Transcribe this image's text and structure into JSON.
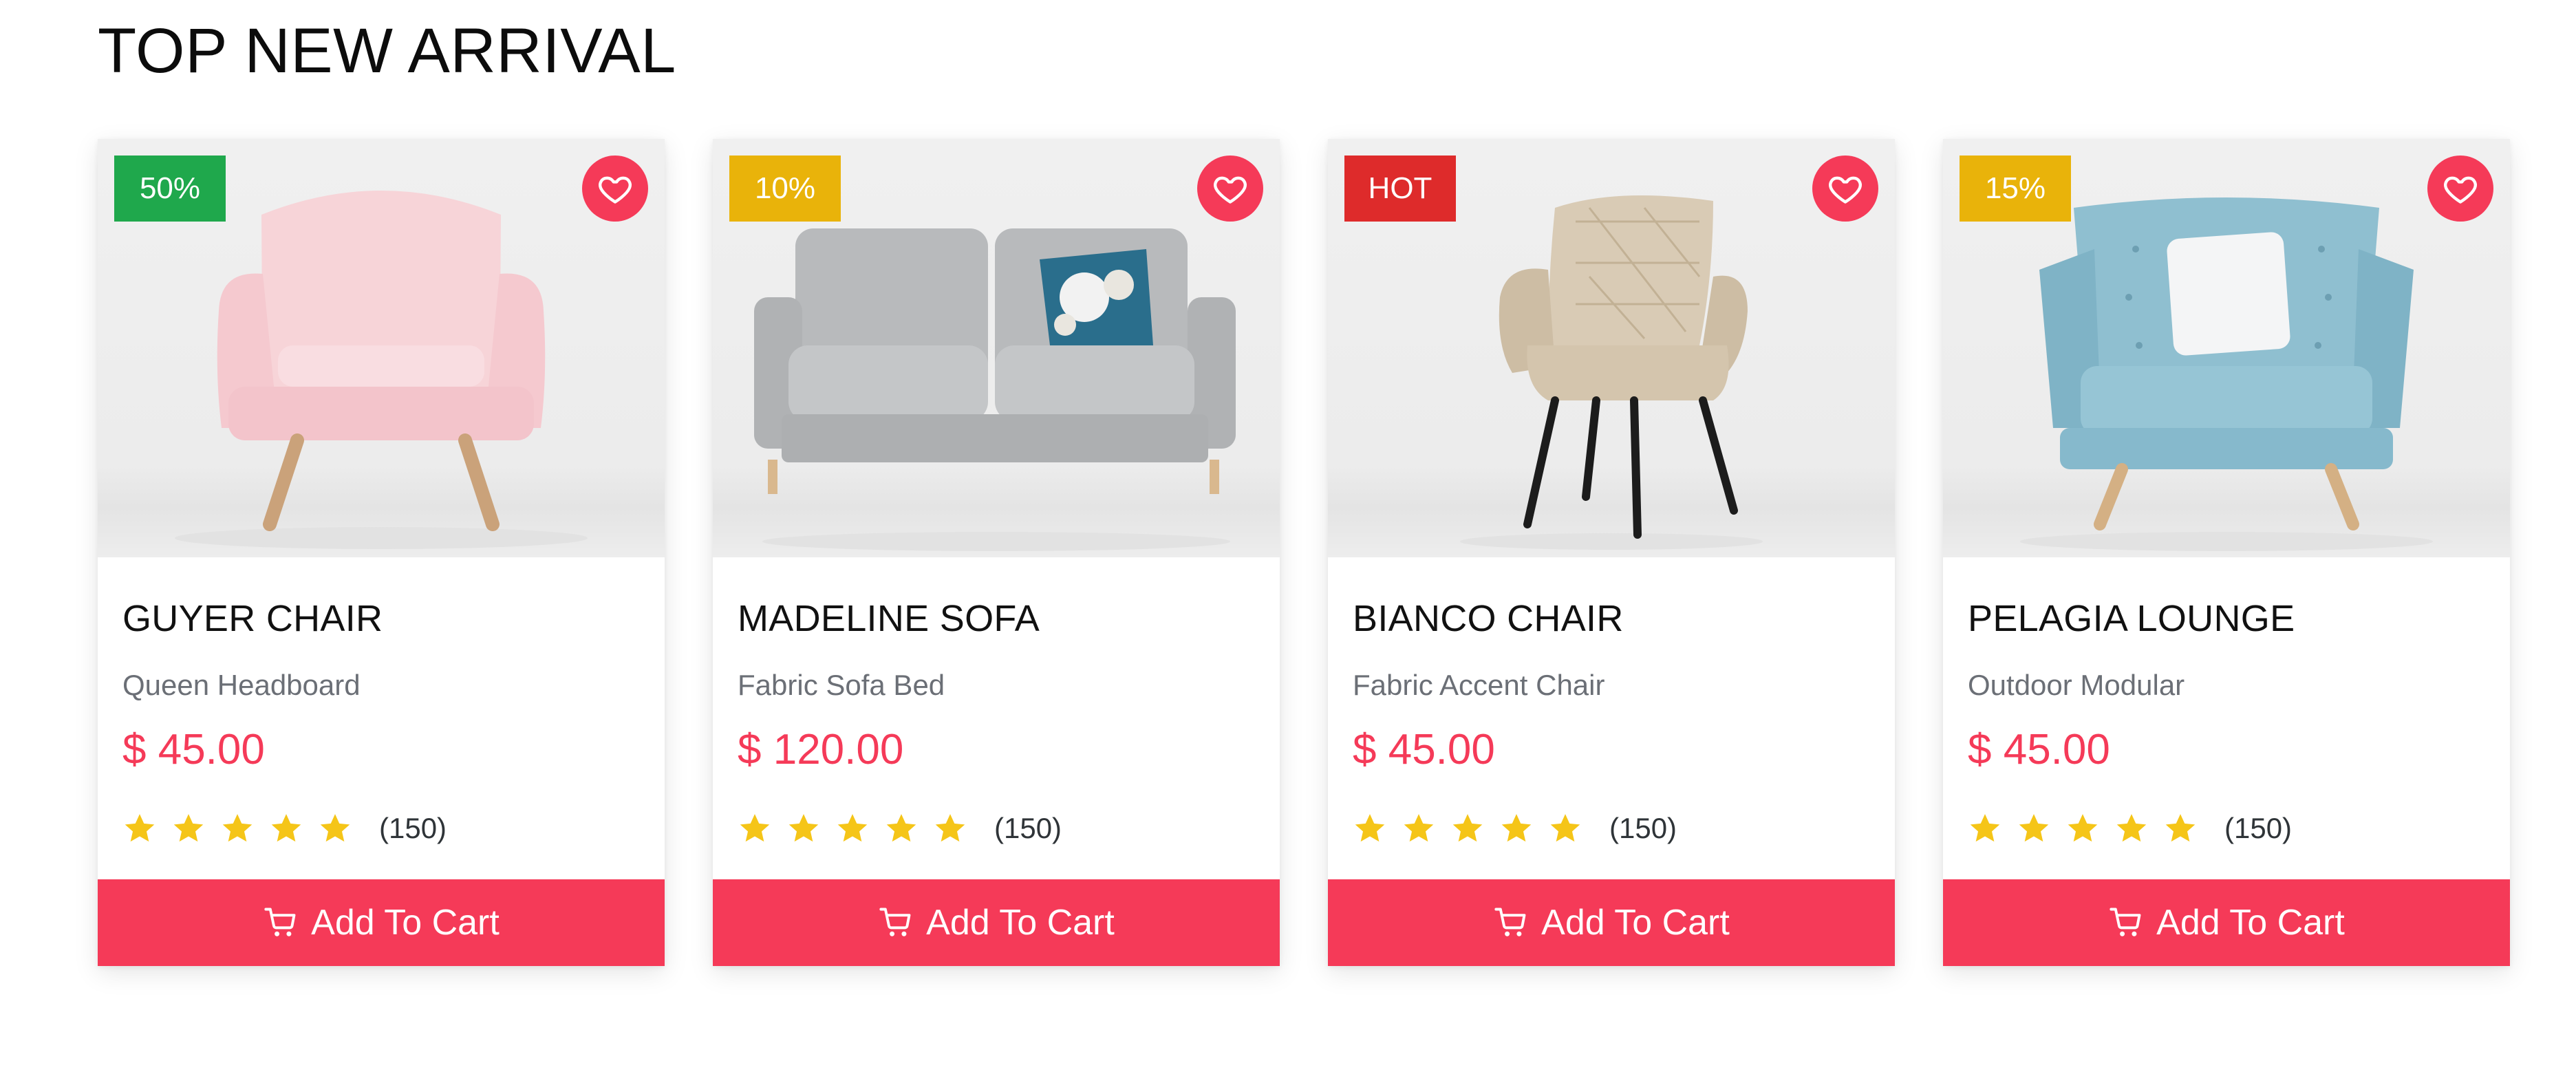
{
  "section": {
    "title": "TOP NEW ARRIVAL"
  },
  "products": [
    {
      "badge": "50%",
      "badge_color": "#1fa84c",
      "name": "GUYER CHAIR",
      "subtitle": "Queen Headboard",
      "price": "$ 45.00",
      "stars": 5,
      "reviews": "(150)",
      "cart_label": "Add To Cart",
      "image_icon": "armchair-icon"
    },
    {
      "badge": "10%",
      "badge_color": "#e9b30a",
      "name": "MADELINE SOFA",
      "subtitle": "Fabric Sofa Bed",
      "price": "$ 120.00",
      "stars": 5,
      "reviews": "(150)",
      "cart_label": "Add To Cart",
      "image_icon": "sofa-icon"
    },
    {
      "badge": "HOT",
      "badge_color": "#de2b2b",
      "name": "BIANCO CHAIR",
      "subtitle": "Fabric Accent Chair",
      "price": "$ 45.00",
      "stars": 5,
      "reviews": "(150)",
      "cart_label": "Add To Cart",
      "image_icon": "accent-chair-icon"
    },
    {
      "badge": "15%",
      "badge_color": "#e9b30a",
      "name": "PELAGIA LOUNGE",
      "subtitle": "Outdoor Modular",
      "price": "$ 45.00",
      "stars": 5,
      "reviews": "(150)",
      "cart_label": "Add To Cart",
      "image_icon": "lounge-chair-icon"
    }
  ],
  "colors": {
    "accent": "#f53a58",
    "star": "#f5c518",
    "muted_text": "#6b6f76"
  },
  "icons": {
    "wishlist": "heart-icon",
    "rating": "star-icon",
    "cart": "cart-icon"
  }
}
